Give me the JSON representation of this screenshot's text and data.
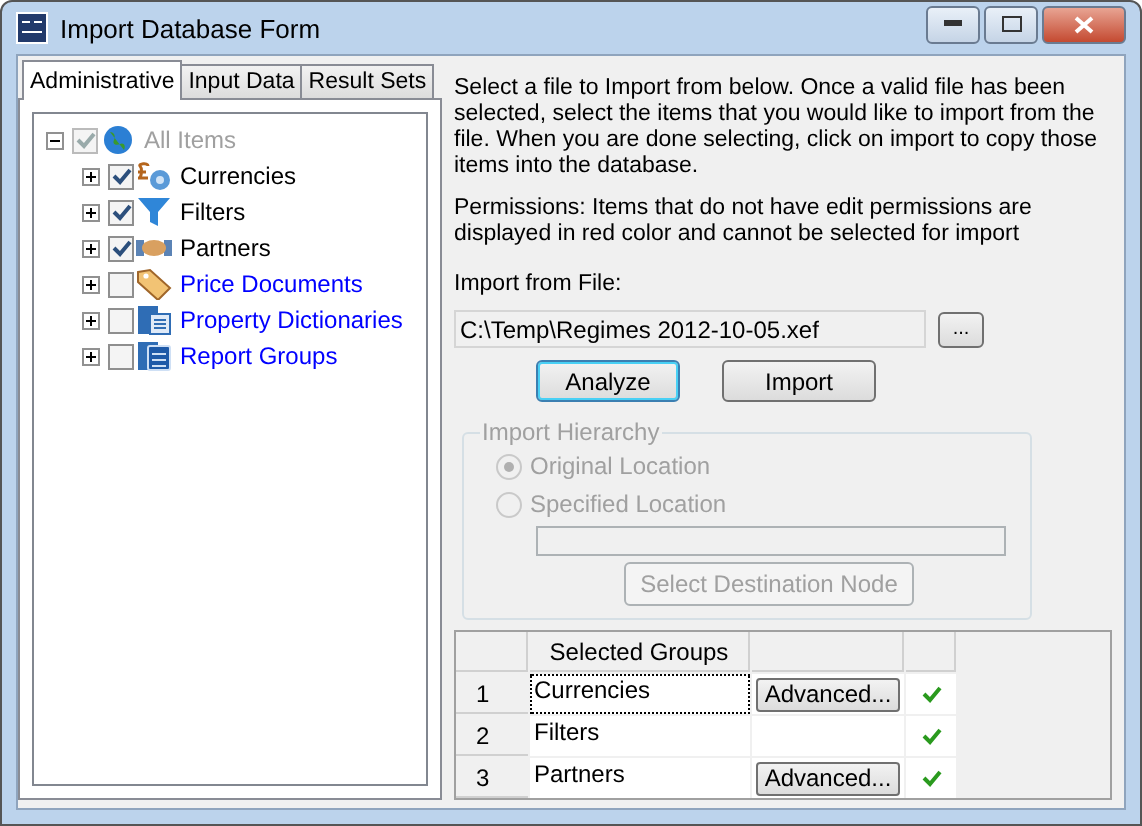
{
  "window": {
    "title": "Import Database Form"
  },
  "tabs": [
    {
      "label": "Administrative",
      "selected": true
    },
    {
      "label": "Input Data",
      "selected": false
    },
    {
      "label": "Result Sets",
      "selected": false
    }
  ],
  "tree": {
    "label": "All Items",
    "kind": "globe",
    "checked": true,
    "disabled": true,
    "expanded": true,
    "children": [
      {
        "label": "Currencies",
        "kind": "currency",
        "checked": true,
        "color": "#000000",
        "expanded": false
      },
      {
        "label": "Filters",
        "kind": "filter",
        "checked": true,
        "color": "#000000",
        "expanded": false
      },
      {
        "label": "Partners",
        "kind": "partner",
        "checked": true,
        "color": "#000000",
        "expanded": false
      },
      {
        "label": "Price Documents",
        "kind": "tag",
        "checked": false,
        "color": "#0000ff",
        "expanded": false
      },
      {
        "label": "Property Dictionaries",
        "kind": "dictionary",
        "checked": false,
        "color": "#0000ff",
        "expanded": false
      },
      {
        "label": "Report Groups",
        "kind": "report",
        "checked": false,
        "color": "#0000ff",
        "expanded": false
      }
    ]
  },
  "instructions": "Select a file to Import from below. Once a valid file has been selected, select the items that you would like to import from the file. When you are done selecting, click on import to copy those items into the database.",
  "permissions": "Permissions: Items that do not have edit permissions are displayed in red color and cannot be selected for import",
  "file": {
    "label": "Import from File:",
    "value": "C:\\Temp\\Regimes 2012-10-05.xef",
    "browse": "..."
  },
  "buttons": [
    {
      "label": "Analyze",
      "default": true
    },
    {
      "label": "Import",
      "default": false
    }
  ],
  "hierarchy": {
    "title": "Import Hierarchy",
    "disabled": true,
    "options": [
      {
        "label": "Original Location",
        "selected": true
      },
      {
        "label": "Specified Location",
        "selected": false
      }
    ],
    "button": "Select Destination Node"
  },
  "grid": {
    "columns": [
      "Selected Groups"
    ],
    "rows": [
      {
        "number": "1",
        "group": "Currencies",
        "action": "Advanced...",
        "focused": true,
        "ok": true
      },
      {
        "number": "2",
        "group": "Filters",
        "focused": false,
        "ok": true
      },
      {
        "number": "3",
        "group": "Partners",
        "action": "Advanced...",
        "focused": false,
        "ok": true
      }
    ]
  }
}
